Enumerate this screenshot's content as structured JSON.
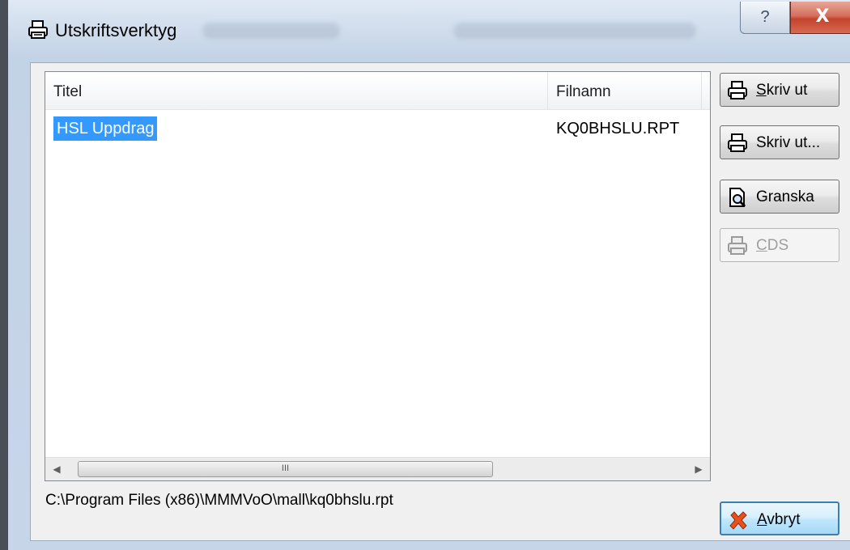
{
  "window": {
    "title": "Utskriftsverktyg",
    "help_glyph": "?",
    "close_glyph": "X"
  },
  "list": {
    "columns": [
      "Titel",
      "Filnamn"
    ],
    "rows": [
      {
        "title": "HSL Uppdrag",
        "filename": "KQ0BHSLU.RPT",
        "selected": true
      }
    ],
    "scroll_thumb_glyph": "III"
  },
  "path": "C:\\Program Files (x86)\\MMMVoO\\mall\\kq0bhslu.rpt",
  "buttons": {
    "print": {
      "accel": "S",
      "rest": "kriv ut",
      "icon": "printer-icon"
    },
    "print_dialog": {
      "label": "Skriv ut...",
      "icon": "printer-icon"
    },
    "preview": {
      "label": "Granska",
      "icon": "preview-icon"
    },
    "cds": {
      "accel": "C",
      "rest": "DS",
      "icon": "cds-icon",
      "disabled": true
    },
    "cancel": {
      "accel": "A",
      "rest": "vbryt",
      "icon": "cancel-x-icon"
    }
  },
  "colors": {
    "selection": "#3399ff",
    "close_button": "#c4432c",
    "dialog_background": "#f0f0f0"
  }
}
